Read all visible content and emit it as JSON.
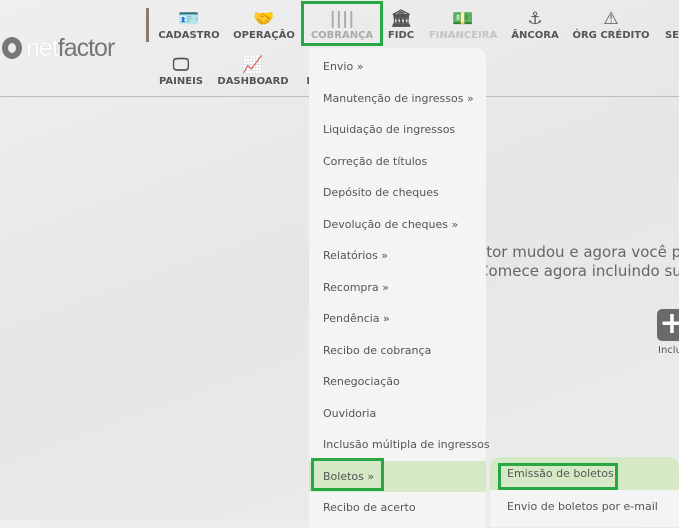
{
  "logo": {
    "text_o": "",
    "text_net": "net",
    "text_factor": "factor"
  },
  "nav": [
    {
      "label": "CADASTRO",
      "icon": "id-card-icon",
      "glyph": "🪪"
    },
    {
      "label": "OPERAÇÃO",
      "icon": "handshake-icon",
      "glyph": "🤝"
    },
    {
      "label": "COBRANÇA",
      "icon": "barcode-icon",
      "glyph": "||||",
      "selected": true
    },
    {
      "label": "FIDC",
      "icon": "bank-icon",
      "glyph": "🏛"
    },
    {
      "label": "FINANCEIRA",
      "icon": "money-icon",
      "glyph": "💵",
      "disabled": true
    },
    {
      "label": "ÂNCORA",
      "icon": "anchor-icon",
      "glyph": "⚓"
    },
    {
      "label": "ÓRG CRÉDITO",
      "icon": "warning-icon",
      "glyph": "⚠"
    },
    {
      "label": "SE",
      "icon": "",
      "glyph": ""
    },
    {
      "label": "PAINEIS",
      "icon": "monitor-icon",
      "glyph": "🖵"
    },
    {
      "label": "DASHBOARD",
      "icon": "area-chart-icon",
      "glyph": "📈"
    },
    {
      "label": "P",
      "icon": "",
      "glyph": ""
    }
  ],
  "menu": [
    "Envio »",
    "Manutenção de ingressos »",
    "Liquidação de ingressos",
    "Correção de títulos",
    "Depósito de cheques",
    "Devolução de cheques »",
    "Relatórios »",
    "Recompra »",
    "Pendência »",
    "Recibo de cobrança",
    "Renegociação",
    "Ouvidoria",
    "Inclusão múltipla de ingressos",
    "Boletos »",
    "Recibo de acerto"
  ],
  "submenu": [
    "Emissão de boletos",
    "Envio de boletos por e-mail"
  ],
  "hero": {
    "line1": "ctor mudou e agora você p",
    "line2": "Comece agora incluindo su",
    "action_label": "Inclu"
  },
  "colors": {
    "highlight": "#d6e9c6",
    "focus_border": "#27a844"
  }
}
